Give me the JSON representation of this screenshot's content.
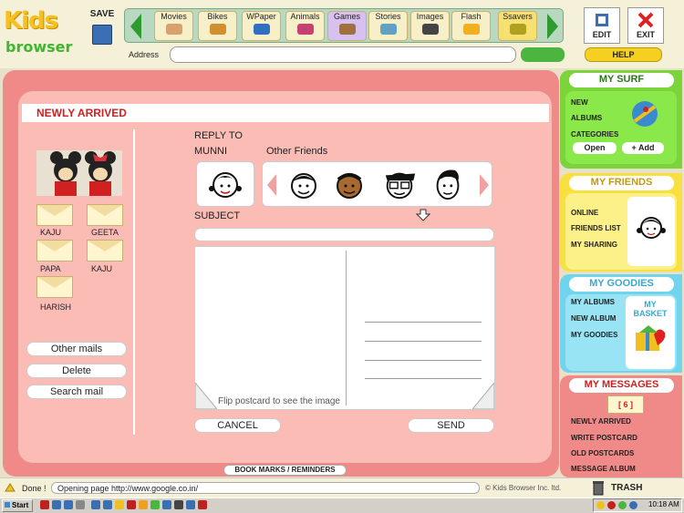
{
  "app": {
    "logo_top": "Kids",
    "logo_bottom": "browser"
  },
  "toolbar": {
    "save_label": "SAVE",
    "categories": [
      "Movies",
      "Bikes",
      "WPaper",
      "Animals",
      "Games",
      "Stories",
      "Images",
      "Flash",
      "Ssavers"
    ],
    "address_label": "Address",
    "address_value": "",
    "edit_label": "EDIT",
    "exit_label": "EXIT",
    "help_label": "HELP"
  },
  "main": {
    "section_title": "NEWLY ARRIVED",
    "contacts": [
      "KAJU",
      "GEETA",
      "PAPA",
      "KAJU",
      "HARISH"
    ],
    "buttons": {
      "other_mails": "Other mails",
      "delete": "Delete",
      "search_mail": "Search mail"
    },
    "reply_to": "REPLY TO",
    "recipient": "MUNNI",
    "other_friends": "Other Friends",
    "subject_label": "SUBJECT",
    "subject_value": "",
    "flip_text": "Flip postcard to see the image",
    "cancel_label": "CANCEL",
    "send_label": "SEND",
    "bookmarks_label": "BOOK MARKS / REMINDERS"
  },
  "right": {
    "my_surf": {
      "title": "MY SURF",
      "links": [
        "NEW",
        "ALBUMS",
        "CATEGORIES"
      ],
      "open": "Open",
      "add": "+ Add"
    },
    "my_friends": {
      "title": "MY FRIENDS",
      "links": [
        "ONLINE",
        "FRIENDS LIST",
        "MY SHARING"
      ]
    },
    "my_goodies": {
      "title": "MY GOODIES",
      "links": [
        "MY ALBUMS",
        "NEW ALBUM",
        "MY GOODIES"
      ],
      "basket": "MY BASKET"
    },
    "my_messages": {
      "title": "MY MESSAGES",
      "count": "[ 6 ]",
      "links": [
        "NEWLY ARRIVED",
        "WRITE POSTCARD",
        "OLD POSTCARDS",
        "MESSAGE ALBUM"
      ]
    },
    "trash_label": "TRASH"
  },
  "status": {
    "done": "Done !",
    "message": "Opening page http://www.google.co.in/",
    "copyright": "Kids Browser Inc. ltd."
  },
  "taskbar": {
    "start": "Start",
    "clock": "10:18 AM"
  },
  "colors": {
    "coral": "#f08a88",
    "pink": "#fbbcb6",
    "green": "#8adc3c",
    "yellow": "#f8e860",
    "cyan": "#80dcf0",
    "red_title": "#d02020"
  }
}
